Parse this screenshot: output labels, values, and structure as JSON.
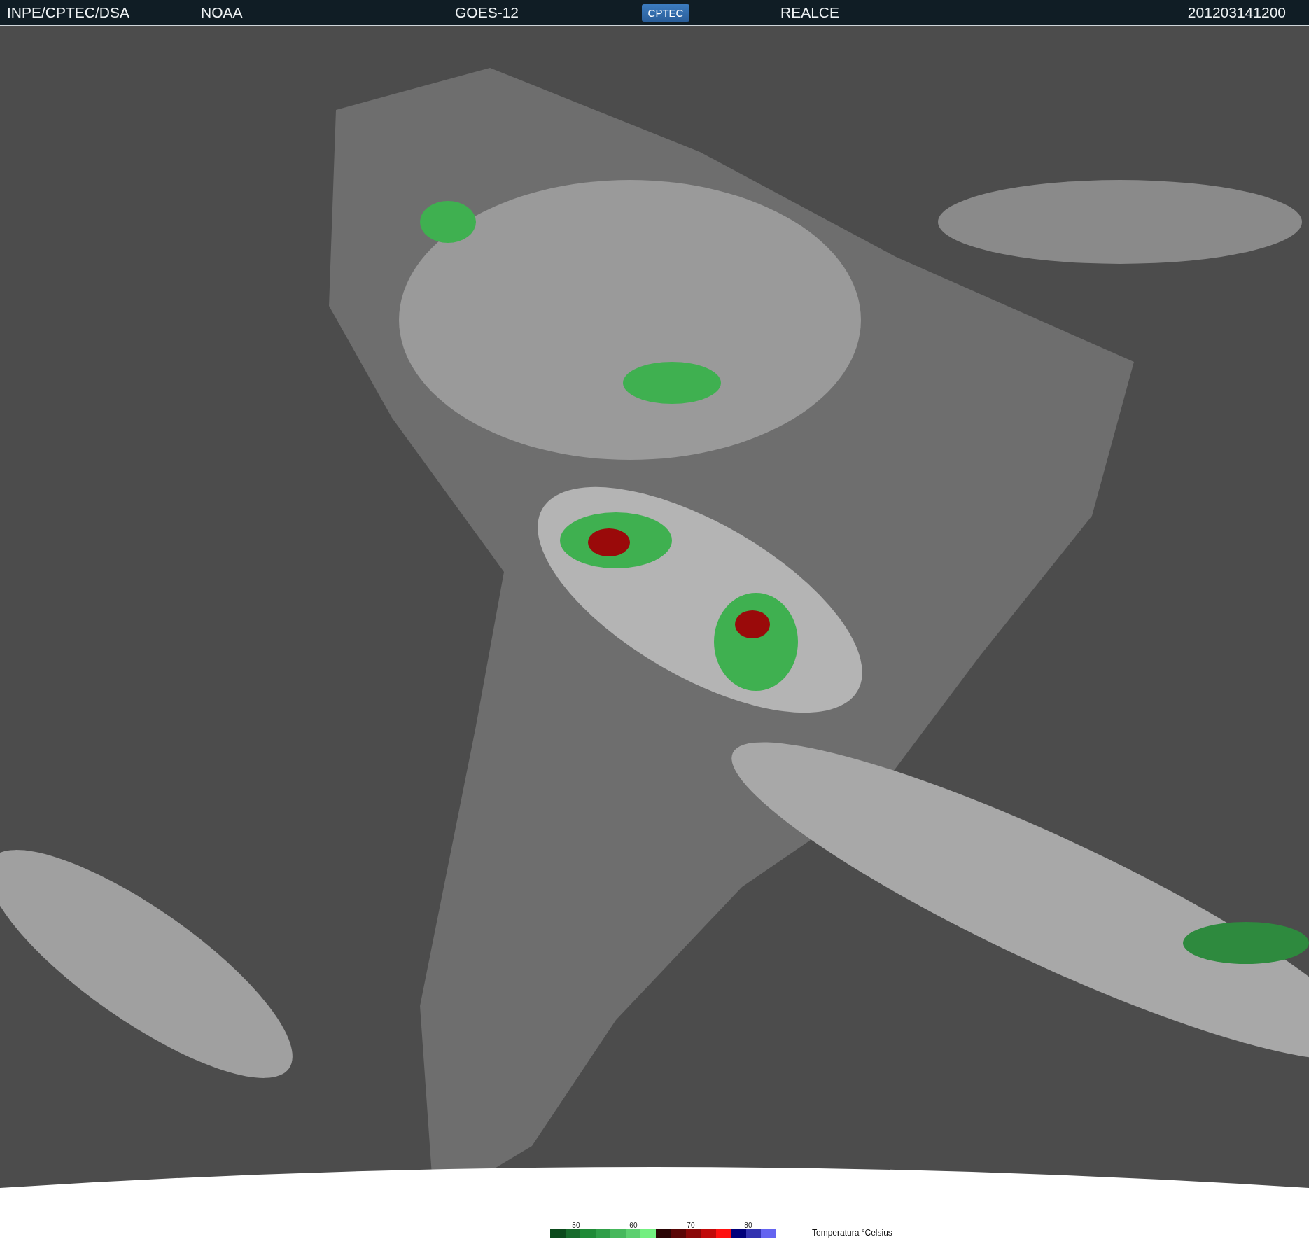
{
  "header": {
    "source": "INPE/CPTEC/DSA",
    "agency": "NOAA",
    "satellite": "GOES-12",
    "logo": "CPTEC",
    "product": "REALCE",
    "timestamp": "201203141200"
  },
  "legend": {
    "ticks": [
      "-50",
      "-60",
      "-70",
      "-80"
    ],
    "unit": "Temperatura °Celsius",
    "swatches": [
      {
        "color": "#0b4a1c"
      },
      {
        "color": "#176b2c"
      },
      {
        "color": "#1f8a37"
      },
      {
        "color": "#2f9e48"
      },
      {
        "color": "#46b85c"
      },
      {
        "color": "#5ccf6f"
      },
      {
        "color": "#73ef80"
      },
      {
        "color": "#2a0505"
      },
      {
        "color": "#5a0606"
      },
      {
        "color": "#8a0808"
      },
      {
        "color": "#c00a0a"
      },
      {
        "color": "#ff1010"
      },
      {
        "color": "#00007a"
      },
      {
        "color": "#3232b0"
      },
      {
        "color": "#6464f0"
      }
    ]
  }
}
